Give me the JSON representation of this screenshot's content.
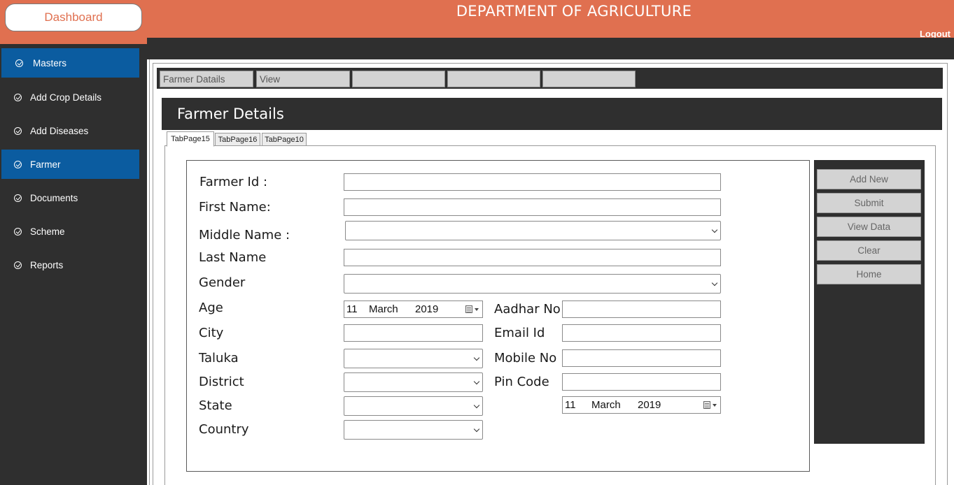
{
  "header": {
    "dashboard_label": "Dashboard",
    "title": "DEPARTMENT OF AGRICULTURE",
    "logout_label": "Logout"
  },
  "sidebar": {
    "items": [
      {
        "label": "Masters",
        "active": true
      },
      {
        "label": "Add Crop Details",
        "active": false
      },
      {
        "label": "Add Diseases",
        "active": false
      },
      {
        "label": "Farmer",
        "active": true
      },
      {
        "label": "Documents",
        "active": false
      },
      {
        "label": "Scheme",
        "active": false
      },
      {
        "label": "Reports",
        "active": false
      }
    ]
  },
  "top_tabs": [
    "Farmer Datails",
    "View",
    "",
    "",
    ""
  ],
  "section": {
    "title": "Farmer Details"
  },
  "sub_tabs": [
    {
      "label": "TabPage15",
      "active": true
    },
    {
      "label": "TabPage16",
      "active": false
    },
    {
      "label": "TabPage10",
      "active": false
    }
  ],
  "form": {
    "farmer_id": {
      "label": "Farmer Id :",
      "value": ""
    },
    "first_name": {
      "label": "First Name:",
      "value": ""
    },
    "middle_name": {
      "label": "Middle Name :",
      "value": ""
    },
    "last_name": {
      "label": "Last Name",
      "value": ""
    },
    "gender": {
      "label": "Gender",
      "value": ""
    },
    "age": {
      "label": "Age",
      "date": {
        "day": "11",
        "month": "March",
        "year": "2019"
      }
    },
    "city": {
      "label": "City",
      "value": ""
    },
    "taluka": {
      "label": "Taluka",
      "value": ""
    },
    "district": {
      "label": "District",
      "value": ""
    },
    "state": {
      "label": "State",
      "value": ""
    },
    "country": {
      "label": "Country",
      "value": ""
    },
    "aadhar_no": {
      "label": "Aadhar No",
      "value": ""
    },
    "email_id": {
      "label": "Email Id",
      "value": ""
    },
    "mobile_no": {
      "label": "Mobile No",
      "value": ""
    },
    "pin_code": {
      "label": "Pin Code",
      "value": ""
    },
    "extra_date": {
      "day": "11",
      "month": "March",
      "year": "2019"
    }
  },
  "actions": [
    "Add New",
    "Submit",
    "View Data",
    "Clear",
    "Home"
  ],
  "colors": {
    "header": "#E07050",
    "sidebar_bg": "#2F2F2F",
    "sidebar_active": "#0B5CA0",
    "button_bg": "#D3D3D3"
  },
  "icons": {
    "sidebar_item": "check-circle-icon",
    "date_picker": "calendar-dropdown-icon",
    "select": "chevron-down-icon"
  }
}
